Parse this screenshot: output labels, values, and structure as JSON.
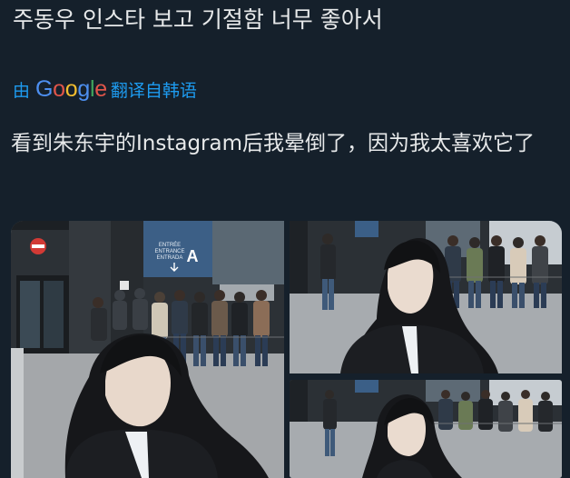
{
  "post": {
    "original_text": "주동우 인스타 보고 기절함 너무 좋아서",
    "translate": {
      "prefix": "由",
      "google_letters": [
        "G",
        "o",
        "o",
        "g",
        "l",
        "e"
      ],
      "suffix": "翻译自韩语"
    },
    "translated_text": "看到朱东宇的Instagram后我晕倒了，因为我太喜欢它了"
  },
  "media": {
    "sign": {
      "line1": "ENTRÉE",
      "line2": "ENTRANCE",
      "line3": "ENTRADA",
      "letter": "A"
    },
    "image_count": 3
  },
  "colors": {
    "background": "#15202b",
    "text": "#e7e9ea",
    "link": "#1d9bf0"
  }
}
